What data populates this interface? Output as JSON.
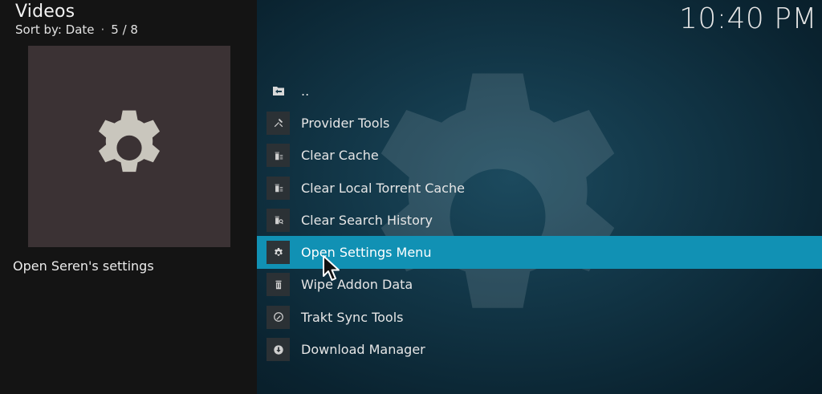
{
  "header": {
    "title": "Videos",
    "sort_label": "Sort by: Date",
    "position": "5 / 8"
  },
  "clock": "10:40 PM",
  "info": {
    "description": "Open Seren's settings",
    "thumbnail_icon": "gear-icon"
  },
  "list": {
    "items": [
      {
        "label": "..",
        "icon": "folder-back-icon"
      },
      {
        "label": "Provider Tools",
        "icon": "tools-icon"
      },
      {
        "label": "Clear Cache",
        "icon": "trash-list-icon"
      },
      {
        "label": "Clear Local Torrent Cache",
        "icon": "trash-list-icon"
      },
      {
        "label": "Clear Search History",
        "icon": "search-trash-icon"
      },
      {
        "label": "Open Settings Menu",
        "icon": "gear-icon",
        "selected": true
      },
      {
        "label": "Wipe Addon Data",
        "icon": "trash-icon"
      },
      {
        "label": "Trakt Sync Tools",
        "icon": "trakt-icon"
      },
      {
        "label": "Download Manager",
        "icon": "download-icon"
      }
    ]
  },
  "colors": {
    "highlight": "#1191b4",
    "left_panel": "#141414",
    "thumbnail_bg": "#3b3234"
  }
}
